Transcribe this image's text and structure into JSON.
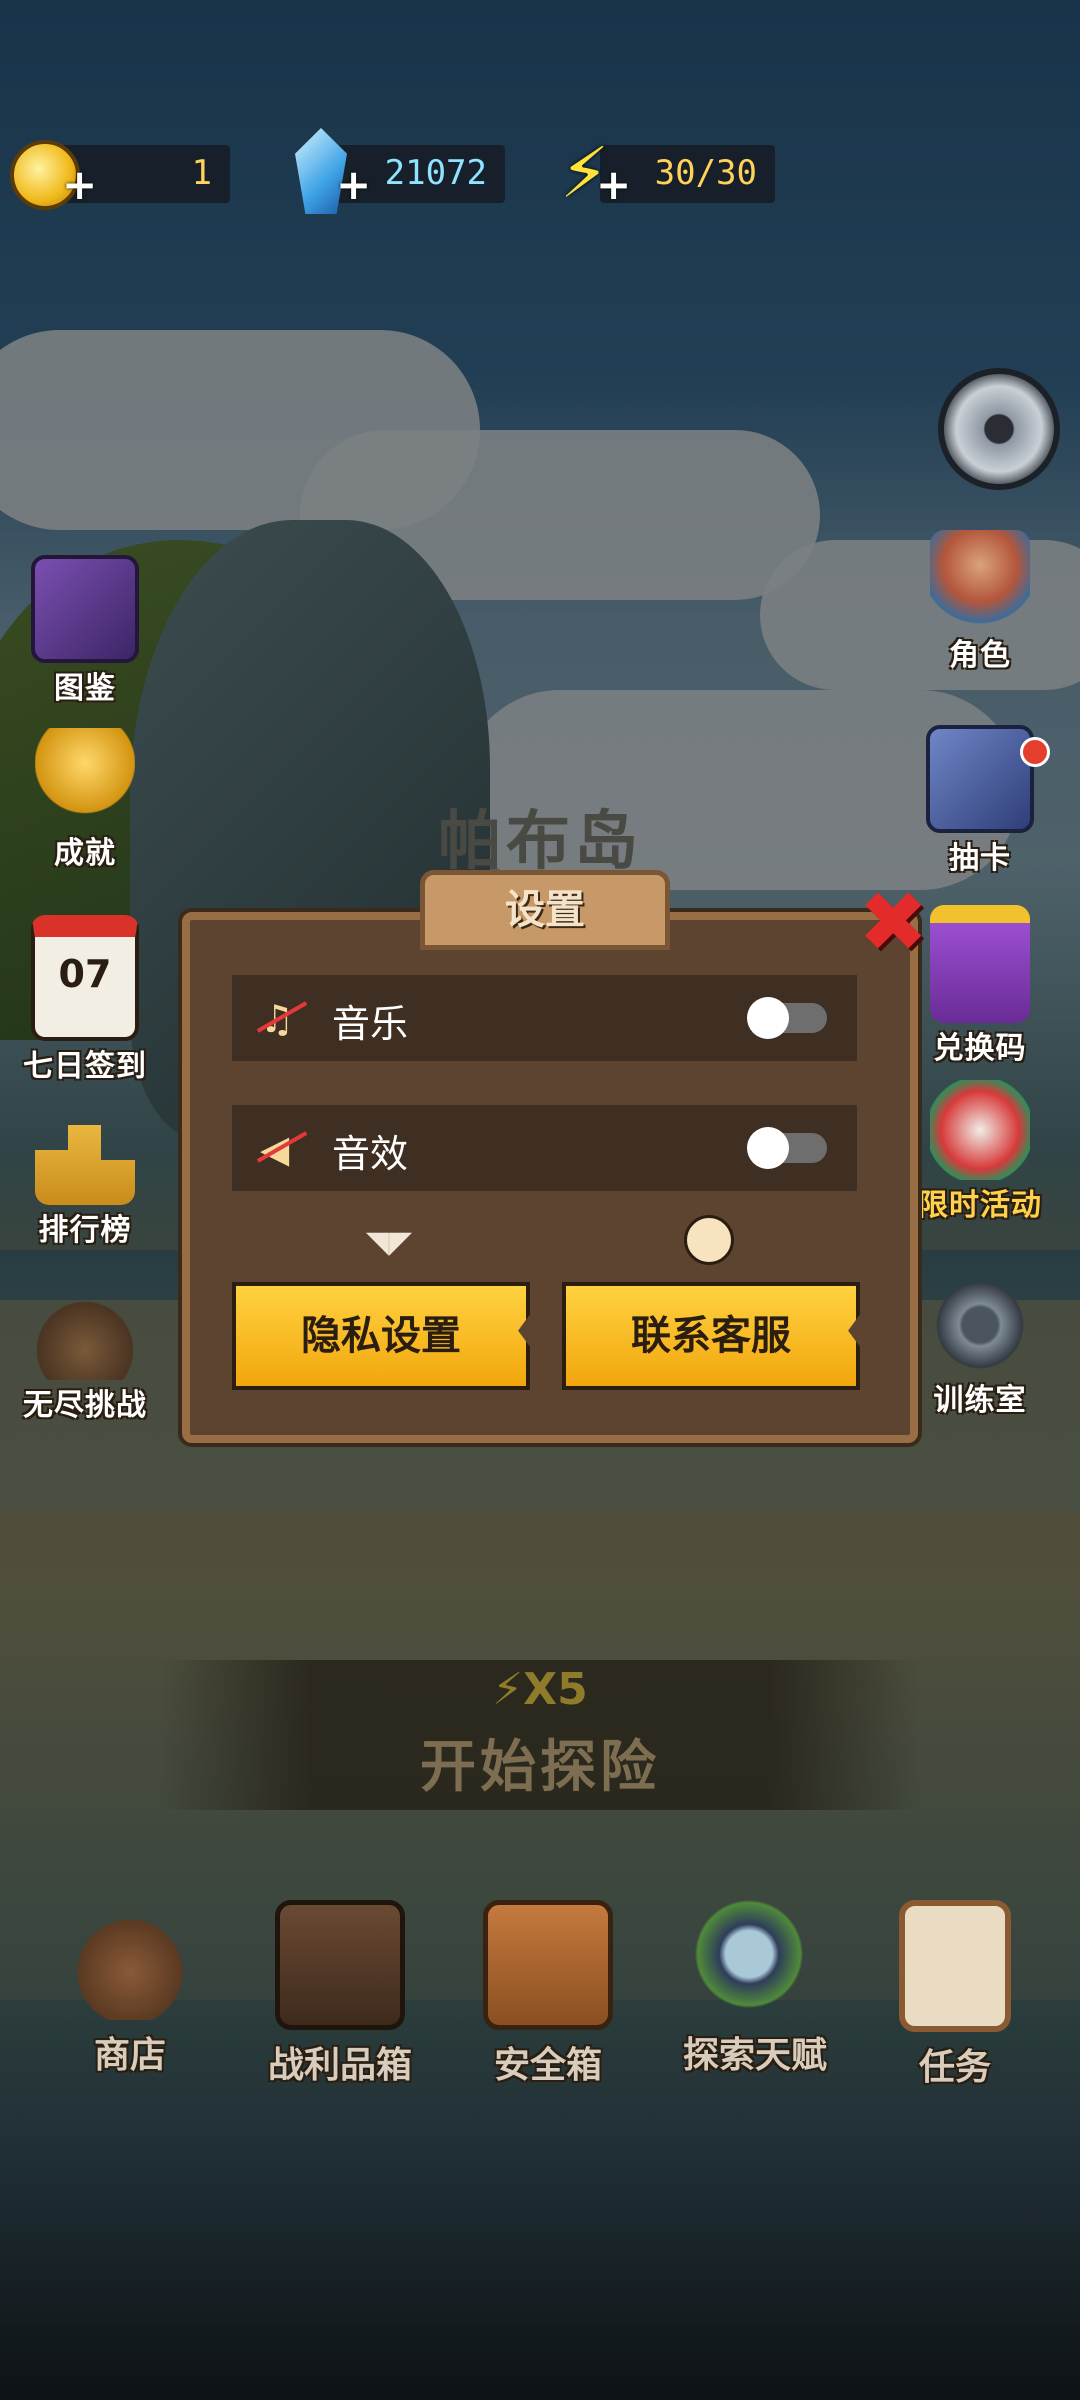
{
  "resources": {
    "gold": "1",
    "diamonds": "21072",
    "energy": "30/30"
  },
  "island_title": "帕布岛",
  "left_menu": [
    "图鉴",
    "成就",
    "七日签到",
    "排行榜",
    "无尽挑战"
  ],
  "calendar_day": "07",
  "right_menu": [
    "角色",
    "抽卡",
    "兑换码",
    "限时活动",
    "训练室"
  ],
  "settings": {
    "title": "设置",
    "music_label": "音乐",
    "sfx_label": "音效",
    "privacy_button": "隐私设置",
    "support_button": "联系客服"
  },
  "start": {
    "cost": "X5",
    "label": "开始探险"
  },
  "bottom_nav": [
    "商店",
    "战利品箱",
    "安全箱",
    "探索天赋",
    "任务"
  ],
  "colors": {
    "accent_yellow": "#ffd240",
    "panel_brown": "#5d4430",
    "close_red": "#e42b2b"
  }
}
